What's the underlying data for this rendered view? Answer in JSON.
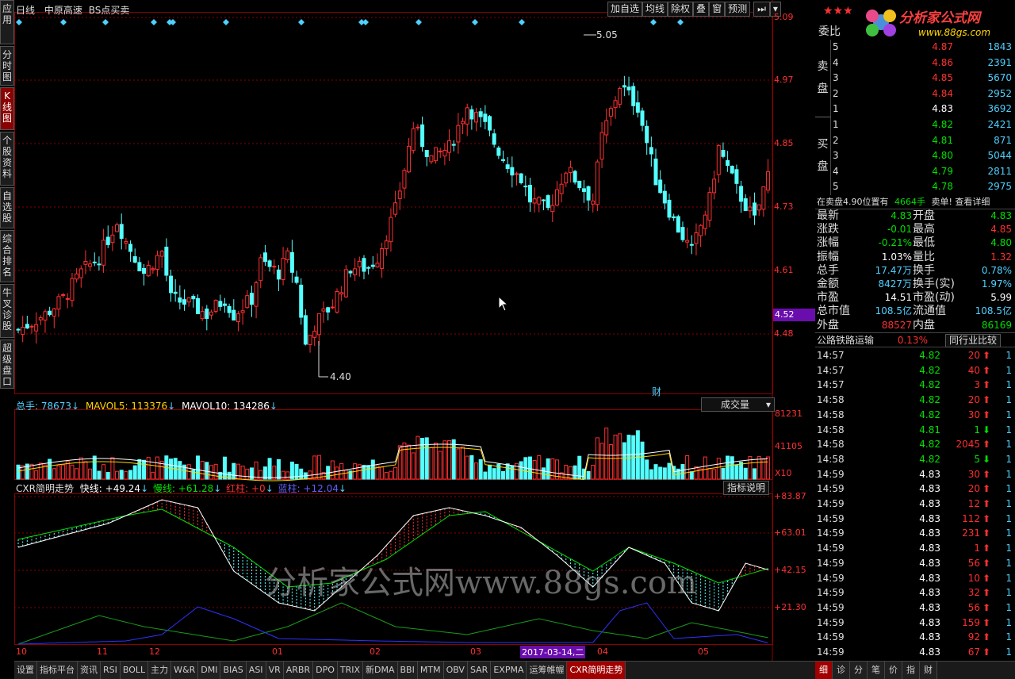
{
  "left_tabs": [
    "应用",
    "分时图",
    "K线图",
    "个股资料",
    "自选股",
    "综合排名",
    "牛叉诊股",
    "超级盘口"
  ],
  "header": {
    "period": "日线",
    "stock": "中原高速",
    "indicator": "BS点买卖"
  },
  "toolbar": [
    "加自选",
    "均线",
    "除权",
    "叠",
    "窗",
    "预测"
  ],
  "price_axis": [
    "5.09",
    "4.97",
    "4.85",
    "4.73",
    "4.61",
    "4.52",
    "4.48"
  ],
  "price_highlight": "4.52",
  "annotations": {
    "high": "5.05",
    "low": "4.40",
    "cai": "财"
  },
  "volume": {
    "label_total": "总手: 78673",
    "mavol5": "MAVOL5: 113376",
    "mavol10": "MAVOL10: 134286",
    "dropdown": "成交量",
    "axis": [
      "81231",
      "41105",
      "X10"
    ]
  },
  "cxr": {
    "name": "CXR简明走势",
    "fast": "快线: +49.24",
    "slow": "慢线: +61.28",
    "red": "红柱: +0",
    "blue": "蓝柱: +12.04",
    "button": "指标说明",
    "axis": [
      "+83.87",
      "+63.01",
      "+42.15",
      "+21.30"
    ]
  },
  "watermark": "分析家公式网www.88gs.com",
  "date_axis": [
    "10",
    "11",
    "12",
    "01",
    "02",
    "03",
    "04",
    "05"
  ],
  "date_highlight": "2017-03-14,二",
  "bottom_tabs": [
    "设置",
    "指标平台",
    "资讯",
    "RSI",
    "BOLL",
    "主力",
    "W&R",
    "DMI",
    "BIAS",
    "ASI",
    "VR",
    "ARBR",
    "DPO",
    "TRIX",
    "新DMA",
    "BBI",
    "MTM",
    "OBV",
    "SAR",
    "EXPMA",
    "运筹帷幄",
    "CXR简明走势"
  ],
  "logo": {
    "text": "分析家公式网",
    "url": "www.88gs.com"
  },
  "order_book": {
    "title": "委比",
    "sell_label": "卖盘",
    "buy_label": "买盘",
    "sell": [
      {
        "lvl": "5",
        "price": "4.87",
        "vol": "1843"
      },
      {
        "lvl": "4",
        "price": "4.86",
        "vol": "2391"
      },
      {
        "lvl": "3",
        "price": "4.85",
        "vol": "5670"
      },
      {
        "lvl": "2",
        "price": "4.84",
        "vol": "2952"
      },
      {
        "lvl": "1",
        "price": "4.83",
        "vol": "3692"
      }
    ],
    "buy": [
      {
        "lvl": "1",
        "price": "4.82",
        "vol": "2421"
      },
      {
        "lvl": "2",
        "price": "4.81",
        "vol": "871"
      },
      {
        "lvl": "3",
        "price": "4.80",
        "vol": "5044"
      },
      {
        "lvl": "4",
        "price": "4.79",
        "vol": "2811"
      },
      {
        "lvl": "5",
        "price": "4.78",
        "vol": "2975"
      }
    ]
  },
  "msg": {
    "a": "在卖盘4.90位置有",
    "b": "4664手",
    "c": "卖单!",
    "d": "查看详细"
  },
  "quote": [
    {
      "l1": "最新",
      "v1": "4.83",
      "c1": "#00e000",
      "l2": "开盘",
      "v2": "4.83",
      "c2": "#00e000"
    },
    {
      "l1": "涨跌",
      "v1": "-0.01",
      "c1": "#00e000",
      "l2": "最高",
      "v2": "4.85",
      "c2": "#ff3030"
    },
    {
      "l1": "涨幅",
      "v1": "-0.21%",
      "c1": "#00e000",
      "l2": "最低",
      "v2": "4.80",
      "c2": "#00e000"
    },
    {
      "l1": "振幅",
      "v1": "1.03%",
      "c1": "#ffffff",
      "l2": "量比",
      "v2": "1.32",
      "c2": "#ff3030"
    },
    {
      "l1": "总手",
      "v1": "17.47万",
      "c1": "#4fd0ff",
      "l2": "换手",
      "v2": "0.78%",
      "c2": "#4fd0ff"
    },
    {
      "l1": "金额",
      "v1": "8427万",
      "c1": "#4fd0ff",
      "l2": "换手(实)",
      "v2": "1.97%",
      "c2": "#4fd0ff"
    },
    {
      "l1": "市盈",
      "v1": "14.51",
      "c1": "#ffffff",
      "l2": "市盈(动)",
      "v2": "5.99",
      "c2": "#ffffff"
    },
    {
      "l1": "总市值",
      "v1": "108.5亿",
      "c1": "#4fd0ff",
      "l2": "流通值",
      "v2": "108.5亿",
      "c2": "#4fd0ff"
    },
    {
      "l1": "外盘",
      "v1": "88527",
      "c1": "#ff3030",
      "l2": "内盘",
      "v2": "86169",
      "c2": "#00e000"
    }
  ],
  "industry": {
    "name": "公路铁路运输",
    "pct": "0.13%",
    "btn": "同行业比较"
  },
  "ticks": [
    {
      "t": "14:57",
      "p": "4.82",
      "v": "20",
      "d": "up",
      "n": "1"
    },
    {
      "t": "14:57",
      "p": "4.82",
      "v": "40",
      "d": "up",
      "n": "1"
    },
    {
      "t": "14:57",
      "p": "4.82",
      "v": "3",
      "d": "up",
      "n": "1"
    },
    {
      "t": "14:58",
      "p": "4.82",
      "v": "20",
      "d": "up",
      "n": "1"
    },
    {
      "t": "14:58",
      "p": "4.82",
      "v": "30",
      "d": "up",
      "n": "1"
    },
    {
      "t": "14:58",
      "p": "4.81",
      "v": "1",
      "d": "down",
      "n": "1"
    },
    {
      "t": "14:58",
      "p": "4.82",
      "v": "2045",
      "d": "up",
      "n": "1"
    },
    {
      "t": "14:58",
      "p": "4.82",
      "v": "5",
      "d": "down",
      "n": "1"
    },
    {
      "t": "14:59",
      "p": "4.83",
      "v": "30",
      "d": "up",
      "n": "1"
    },
    {
      "t": "14:59",
      "p": "4.83",
      "v": "20",
      "d": "up",
      "n": "1"
    },
    {
      "t": "14:59",
      "p": "4.83",
      "v": "12",
      "d": "up",
      "n": "1"
    },
    {
      "t": "14:59",
      "p": "4.83",
      "v": "112",
      "d": "up",
      "n": "1"
    },
    {
      "t": "14:59",
      "p": "4.83",
      "v": "231",
      "d": "up",
      "n": "1"
    },
    {
      "t": "14:59",
      "p": "4.83",
      "v": "1",
      "d": "up",
      "n": "1"
    },
    {
      "t": "14:59",
      "p": "4.83",
      "v": "56",
      "d": "up",
      "n": "1"
    },
    {
      "t": "14:59",
      "p": "4.83",
      "v": "10",
      "d": "up",
      "n": "1"
    },
    {
      "t": "14:59",
      "p": "4.83",
      "v": "32",
      "d": "up",
      "n": "1"
    },
    {
      "t": "14:59",
      "p": "4.83",
      "v": "56",
      "d": "up",
      "n": "1"
    },
    {
      "t": "14:59",
      "p": "4.83",
      "v": "159",
      "d": "up",
      "n": "1"
    },
    {
      "t": "14:59",
      "p": "4.83",
      "v": "92",
      "d": "up",
      "n": "1"
    },
    {
      "t": "14:59",
      "p": "4.83",
      "v": "67",
      "d": "up",
      "n": "1"
    }
  ],
  "right_tabs": [
    "细",
    "诊",
    "分",
    "笔",
    "价",
    "指",
    "财"
  ]
}
